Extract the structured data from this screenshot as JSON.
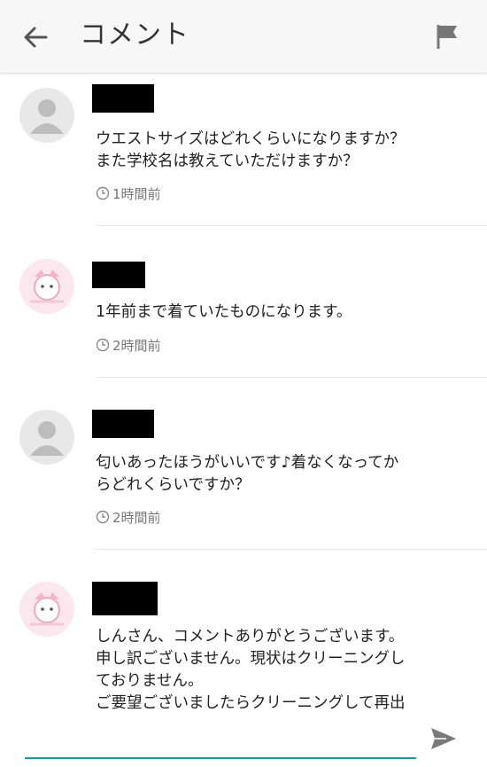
{
  "header": {
    "title": "コメント",
    "back_icon": "arrow-left-icon",
    "flag_icon": "flag-icon"
  },
  "comments": [
    {
      "avatar": "default-user-icon",
      "name_redacted": "",
      "text": "ウエストサイズはどれくらいになりますか？\nまた学校名は教えていただけますか？",
      "time": "1時間前"
    },
    {
      "avatar": "seller-avatar",
      "name_redacted": "",
      "text": "1年前まで着ていたものになります。",
      "time": "2時間前"
    },
    {
      "avatar": "default-user-icon",
      "name_redacted": "",
      "text": "匂いあったほうがいいです♪着なくなってか\nらどれくらいですか？",
      "time": "2時間前"
    },
    {
      "avatar": "seller-avatar",
      "name_redacted": "",
      "text": "しんさん、コメントありがとうございます。\n申し訳ございません。現状はクリーニングし\nておりません。\nご要望ございましたらクリーニングして再出",
      "time": ""
    }
  ],
  "composer": {
    "placeholder": "",
    "send_icon": "send-icon",
    "accent": "#1a9a9a"
  }
}
